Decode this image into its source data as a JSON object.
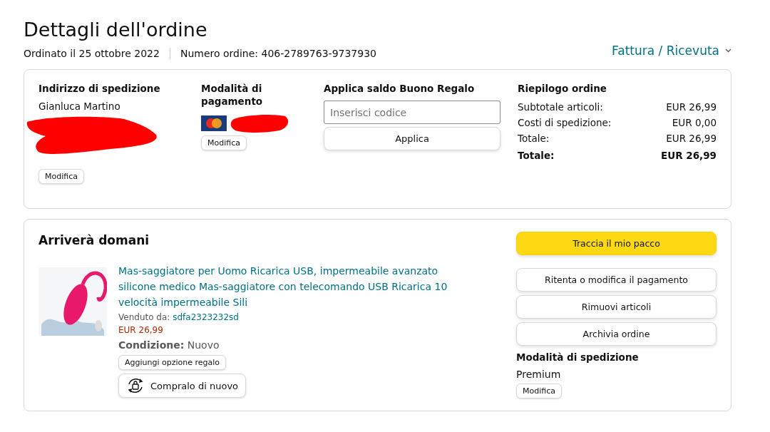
{
  "page": {
    "title": "Dettagli dell'ordine",
    "order_date": "Ordinato il 25 ottobre 2022",
    "order_number": "Numero ordine: 406-2789763-9737930",
    "invoice_link": "Fattura / Ricevuta"
  },
  "summary": {
    "shipping_address": {
      "heading": "Indirizzo di spedizione",
      "name": "Gianluca Martino",
      "redacted": true,
      "button": "Modifica"
    },
    "payment": {
      "heading": "Modalità di pagamento",
      "redacted": true,
      "button": "Modifica"
    },
    "gift_card": {
      "heading": "Applica saldo Buono Regalo",
      "placeholder": "Inserisci codice",
      "button": "Applica"
    },
    "order_summary": {
      "heading": "Riepilogo ordine",
      "rows": [
        {
          "label": "Subtotale articoli:",
          "value": "EUR 26,99",
          "bold": false
        },
        {
          "label": "Costi di spedizione:",
          "value": "EUR 0,00",
          "bold": false
        },
        {
          "label": "Totale:",
          "value": "EUR 26,99",
          "bold": false
        },
        {
          "label": "Totale:",
          "value": "EUR 26,99",
          "bold": true
        }
      ]
    }
  },
  "shipment": {
    "heading": "Arriverà domani",
    "item": {
      "title": "Mas-saggiatore per Uomo Ricarica USB, impermeabile avanzato silicone medico Mas-saggiatore con telecomando USB Ricarica 10 velocità impermeabile Sili",
      "sold_by_label": "Venduto da:",
      "seller": "sdfa2323232sd",
      "price": "EUR 26,99",
      "condition_label": "Condizione:",
      "condition": "Nuovo",
      "gift_button": "Aggiungi opzione regalo",
      "buy_again": "Compralo di nuovo"
    },
    "actions": [
      {
        "label": "Traccia il mio pacco",
        "kind": "primary"
      },
      {
        "label": "Ritenta o modifica il pagamento",
        "kind": "secondary"
      },
      {
        "label": "Rimuovi articoli",
        "kind": "secondary"
      },
      {
        "label": "Archivia ordine",
        "kind": "secondary"
      }
    ],
    "shipping_method": {
      "heading": "Modalità di spedizione",
      "value": "Premium",
      "button": "Modifica"
    }
  }
}
